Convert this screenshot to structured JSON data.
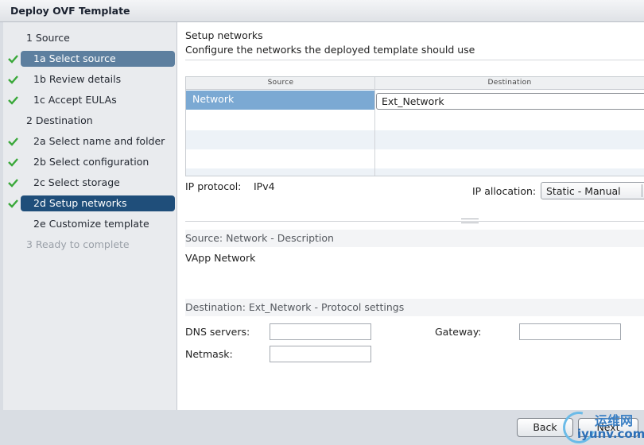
{
  "window": {
    "title": "Deploy OVF Template"
  },
  "sidebar": {
    "items": [
      {
        "label": "1  Source"
      },
      {
        "label": "1a  Select source"
      },
      {
        "label": "1b  Review details"
      },
      {
        "label": "1c  Accept EULAs"
      },
      {
        "label": "2  Destination"
      },
      {
        "label": "2a  Select name and folder"
      },
      {
        "label": "2b  Select configuration"
      },
      {
        "label": "2c  Select storage"
      },
      {
        "label": "2d  Setup networks"
      },
      {
        "label": "2e  Customize template"
      },
      {
        "label": "3  Ready to complete"
      }
    ]
  },
  "main": {
    "title": "Setup networks",
    "subtitle": "Configure the networks the deployed template should use",
    "grid": {
      "headers": [
        "Source",
        "Destination"
      ],
      "rows": [
        {
          "source": "Network",
          "destination": "Ext_Network"
        }
      ]
    },
    "ip_protocol_label": "IP protocol:",
    "ip_protocol_value": "IPv4",
    "ip_allocation_label": "IP allocation:",
    "ip_allocation_value": "Static - Manual",
    "source_section": {
      "header": "Source: Network - Description",
      "description": "VApp Network"
    },
    "dest_section": {
      "header": "Destination: Ext_Network - Protocol settings",
      "dns_label": "DNS servers:",
      "gateway_label": "Gateway:",
      "netmask_label": "Netmask:",
      "dns_value": "",
      "gateway_value": "",
      "netmask_value": ""
    }
  },
  "footer": {
    "back_label": "Back",
    "next_label": "Next"
  },
  "watermark": {
    "line1": "运维网",
    "line2": "iyunv.com"
  },
  "colors": {
    "selected": "#1f4e7a",
    "visited": "#5d7f9f",
    "check": "#3aa83a",
    "row_selected": "#7ba9d3"
  }
}
